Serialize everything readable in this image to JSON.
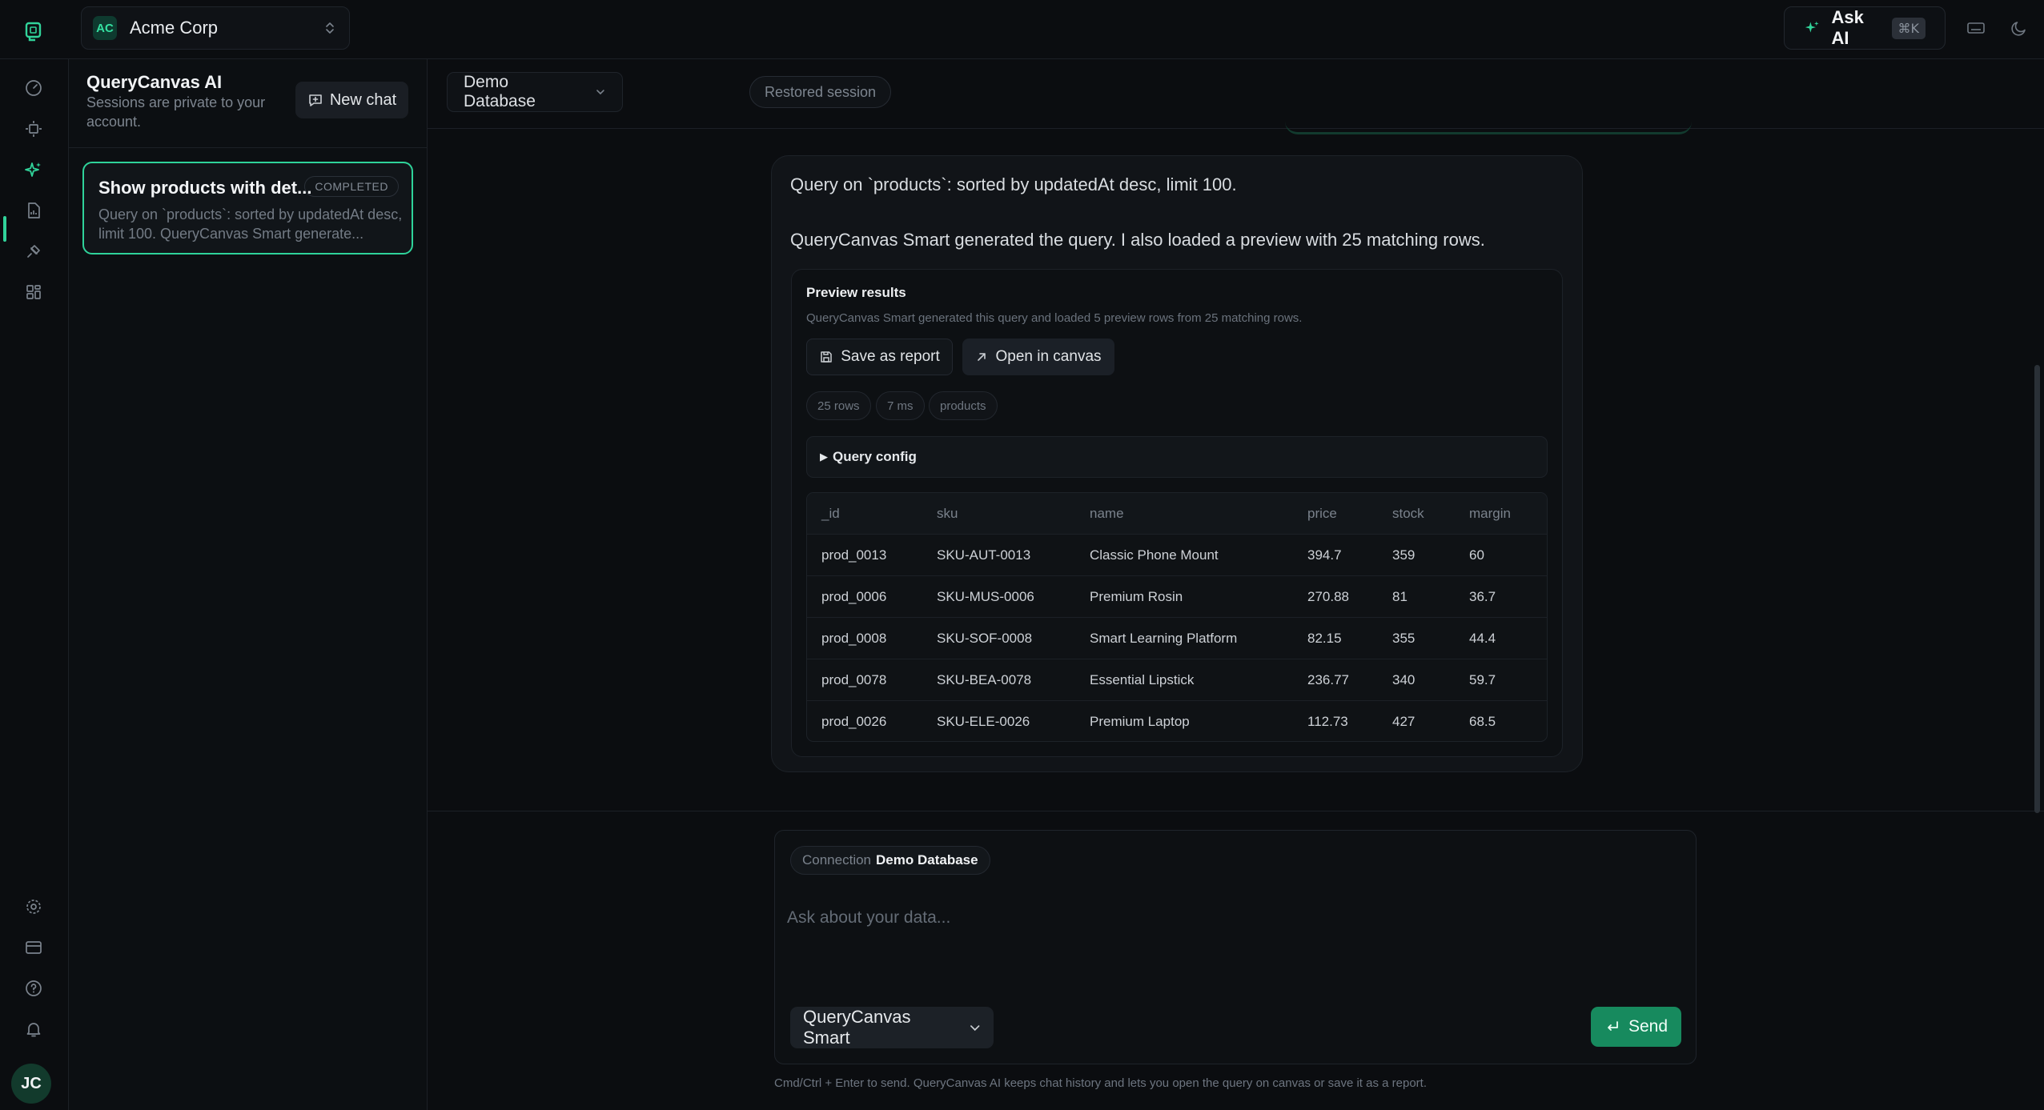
{
  "colors": {
    "accent": "#31d39a",
    "background": "#0b0d10",
    "send": "#178a5e"
  },
  "topbar": {
    "org_initials": "AC",
    "org_name": "Acme Corp",
    "ask_ai_label": "Ask AI",
    "ask_ai_shortcut": "⌘K"
  },
  "rail": {
    "icons": [
      "dashboard-icon",
      "schema-icon",
      "sparkles-icon",
      "reports-icon",
      "plug-icon",
      "grid-icon"
    ],
    "bottom_icons": [
      "settings-icon",
      "billing-icon",
      "help-icon",
      "bell-icon"
    ],
    "user_initials": "JC"
  },
  "sessions": {
    "title": "QueryCanvas AI",
    "subtitle": "Sessions are private to your account.",
    "new_chat_label": "New chat",
    "items": [
      {
        "title": "Show products with det...",
        "status": "COMPLETED",
        "preview": "Query on `products`: sorted by updatedAt desc, limit 100. QueryCanvas Smart generate..."
      }
    ]
  },
  "main": {
    "database": "Demo Database",
    "session_badge": "Restored session"
  },
  "message": {
    "line1": "Query on `products`: sorted by updatedAt desc, limit 100.",
    "line2": "QueryCanvas Smart generated the query. I also loaded a preview with 25 matching rows.",
    "preview": {
      "title": "Preview results",
      "subtitle": "QueryCanvas Smart generated this query and loaded 5 preview rows from 25 matching rows.",
      "save_label": "Save as report",
      "open_label": "Open in canvas",
      "chips": [
        "25 rows",
        "7 ms",
        "products"
      ],
      "query_config_label": "Query config",
      "columns": [
        "_id",
        "sku",
        "name",
        "price",
        "stock",
        "margin"
      ],
      "rows": [
        [
          "prod_0013",
          "SKU-AUT-0013",
          "Classic Phone Mount",
          "394.7",
          "359",
          "60"
        ],
        [
          "prod_0006",
          "SKU-MUS-0006",
          "Premium Rosin",
          "270.88",
          "81",
          "36.7"
        ],
        [
          "prod_0008",
          "SKU-SOF-0008",
          "Smart Learning Platform",
          "82.15",
          "355",
          "44.4"
        ],
        [
          "prod_0078",
          "SKU-BEA-0078",
          "Essential Lipstick",
          "236.77",
          "340",
          "59.7"
        ],
        [
          "prod_0026",
          "SKU-ELE-0026",
          "Premium Laptop",
          "112.73",
          "427",
          "68.5"
        ]
      ]
    }
  },
  "composer": {
    "connection_label": "Connection",
    "connection_value": "Demo Database",
    "placeholder": "Ask about your data...",
    "model": "QueryCanvas Smart",
    "send_label": "Send",
    "hint": "Cmd/Ctrl + Enter to send. QueryCanvas AI keeps chat history and lets you open the query on canvas or save it as a report."
  }
}
